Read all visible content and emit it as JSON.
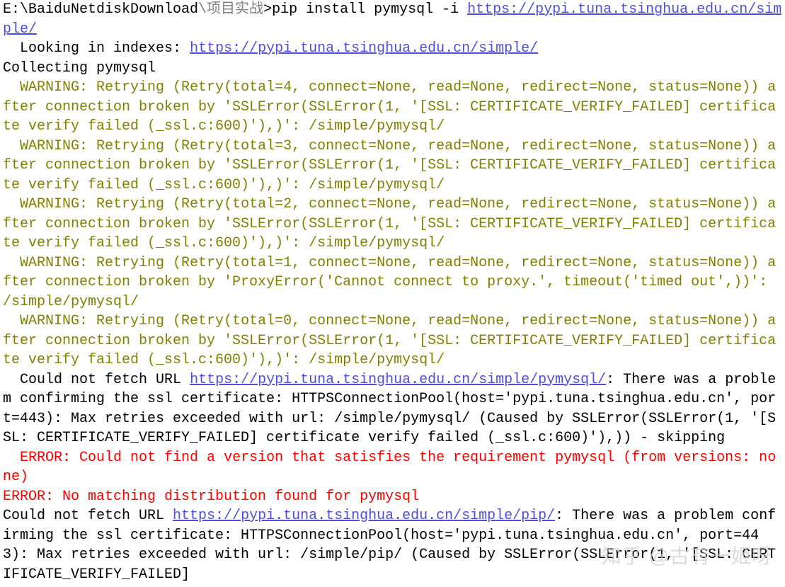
{
  "prompt": {
    "path_white": "E:\\BaiduNetdiskDownload",
    "path_grey": "\\项目实战",
    "marker": ">",
    "command": "pip install pymysql -i ",
    "url": "https://pypi.tuna.tsinghua.edu.cn/simple/"
  },
  "looking_prefix": "  Looking in indexes: ",
  "looking_url": "https://pypi.tuna.tsinghua.edu.cn/simple/",
  "collecting": "Collecting pymysql",
  "warn_pad": "  ",
  "warning4": "WARNING: Retrying (Retry(total=4, connect=None, read=None, redirect=None, status=None)) after connection broken by 'SSLError(SSLError(1, '[SSL: CERTIFICATE_VERIFY_FAILED] certificate verify failed (_ssl.c:600)'),)': /simple/pymysql/",
  "warning3": "WARNING: Retrying (Retry(total=3, connect=None, read=None, redirect=None, status=None)) after connection broken by 'SSLError(SSLError(1, '[SSL: CERTIFICATE_VERIFY_FAILED] certificate verify failed (_ssl.c:600)'),)': /simple/pymysql/",
  "warning2": "WARNING: Retrying (Retry(total=2, connect=None, read=None, redirect=None, status=None)) after connection broken by 'SSLError(SSLError(1, '[SSL: CERTIFICATE_VERIFY_FAILED] certificate verify failed (_ssl.c:600)'),)': /simple/pymysql/",
  "warning1": "WARNING: Retrying (Retry(total=1, connect=None, read=None, redirect=None, status=None)) after connection broken by 'ProxyError('Cannot connect to proxy.', timeout('timed out',))': /simple/pymysql/",
  "warning0": "WARNING: Retrying (Retry(total=0, connect=None, read=None, redirect=None, status=None)) after connection broken by 'SSLError(SSLError(1, '[SSL: CERTIFICATE_VERIFY_FAILED] certificate verify failed (_ssl.c:600)'),)': /simple/pymysql/",
  "fetch1_prefix": "  Could not fetch URL ",
  "fetch1_url": "https://pypi.tuna.tsinghua.edu.cn/simple/pymysql/",
  "fetch1_rest": ": There was a problem confirming the ssl certificate: HTTPSConnectionPool(host='pypi.tuna.tsinghua.edu.cn', port=443): Max retries exceeded with url: /simple/pymysql/ (Caused by SSLError(SSLError(1, '[SSL: CERTIFICATE_VERIFY_FAILED] certificate verify failed (_ssl.c:600)'),)) - skipping",
  "error_pad": "  ",
  "error1": "ERROR: Could not find a version that satisfies the requirement pymysql (from versions: none)",
  "error2": "ERROR: No matching distribution found for pymysql",
  "fetch2_prefix": "Could not fetch URL ",
  "fetch2_url": "https://pypi.tuna.tsinghua.edu.cn/simple/pip/",
  "fetch2_rest": ": There was a problem confirming the ssl certificate: HTTPSConnectionPool(host='pypi.tuna.tsinghua.edu.cn', port=443): Max retries exceeded with url: /simple/pip/ (Caused by SSLError(SSLError(1, '[SSL: CERTIFICATE_VERIFY_FAILED]",
  "watermark": "知乎 @古有一姬呀"
}
